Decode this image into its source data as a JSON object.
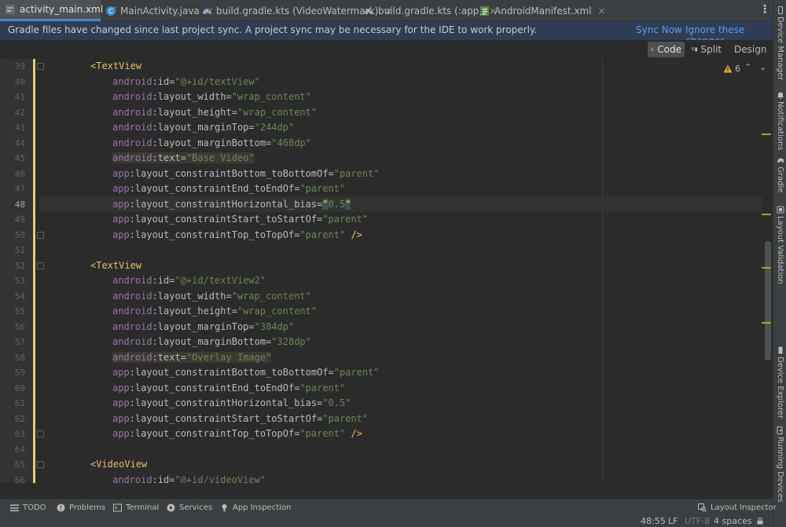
{
  "tabs": [
    {
      "label": "activity_main.xml",
      "icon": "xml-layout-icon",
      "active": true
    },
    {
      "label": "MainActivity.java",
      "icon": "java-class-icon",
      "active": false
    },
    {
      "label": "build.gradle.kts (VideoWatermark)",
      "icon": "gradle-icon",
      "active": false
    },
    {
      "label": "build.gradle.kts (:app)",
      "icon": "gradle-icon",
      "active": false
    },
    {
      "label": "AndroidManifest.xml",
      "icon": "manifest-icon",
      "active": false
    }
  ],
  "tab_close_glyph": "×",
  "tab_menu_glyph": "⋮",
  "banner": {
    "text": "Gradle files have changed since last project sync. A project sync may be necessary for the IDE to work properly.",
    "sync_now": "Sync Now",
    "ignore": "Ignore these changes"
  },
  "view_modes": {
    "code": "Code",
    "split": "Split",
    "design": "Design"
  },
  "inspections": {
    "warning_count": "6",
    "up_glyph": "⌃",
    "down_glyph": "⌄"
  },
  "editor": {
    "current_line": "48",
    "lines": [
      {
        "n": "39",
        "tokens": [
          {
            "t": "tag",
            "v": "<TextView"
          }
        ]
      },
      {
        "n": "40",
        "tokens": [
          {
            "t": "ns",
            "v": "android"
          },
          {
            "t": "attr",
            "v": ":id="
          },
          {
            "t": "str",
            "v": "\"@+id/textView\""
          }
        ]
      },
      {
        "n": "41",
        "tokens": [
          {
            "t": "ns",
            "v": "android"
          },
          {
            "t": "attr",
            "v": ":layout_width="
          },
          {
            "t": "str",
            "v": "\"wrap_content\""
          }
        ]
      },
      {
        "n": "42",
        "tokens": [
          {
            "t": "ns",
            "v": "android"
          },
          {
            "t": "attr",
            "v": ":layout_height="
          },
          {
            "t": "str",
            "v": "\"wrap_content\""
          }
        ]
      },
      {
        "n": "43",
        "tokens": [
          {
            "t": "ns",
            "v": "android"
          },
          {
            "t": "attr",
            "v": ":layout_marginTop="
          },
          {
            "t": "str",
            "v": "\"244dp\""
          }
        ]
      },
      {
        "n": "44",
        "tokens": [
          {
            "t": "ns",
            "v": "android"
          },
          {
            "t": "attr",
            "v": ":layout_marginBottom="
          },
          {
            "t": "str",
            "v": "\"468dp\""
          }
        ]
      },
      {
        "n": "45",
        "hl": true,
        "tokens": [
          {
            "t": "ns",
            "v": "android"
          },
          {
            "t": "attr",
            "v": ":text="
          },
          {
            "t": "str",
            "v": "\"Base Video\""
          }
        ]
      },
      {
        "n": "46",
        "tokens": [
          {
            "t": "ns",
            "v": "app"
          },
          {
            "t": "attr",
            "v": ":layout_constraintBottom_toBottomOf="
          },
          {
            "t": "str",
            "v": "\"parent\""
          }
        ]
      },
      {
        "n": "47",
        "tokens": [
          {
            "t": "ns",
            "v": "app"
          },
          {
            "t": "attr",
            "v": ":layout_constraintEnd_toEndOf="
          },
          {
            "t": "str",
            "v": "\"parent\""
          }
        ]
      },
      {
        "n": "48",
        "tokens": [
          {
            "t": "ns",
            "v": "app"
          },
          {
            "t": "attr",
            "v": ":layout_constraintHorizontal_bias="
          },
          {
            "t": "bracehl",
            "v": "\""
          },
          {
            "t": "str",
            "v": "0.5"
          },
          {
            "t": "bracehl",
            "v": "\""
          }
        ]
      },
      {
        "n": "49",
        "tokens": [
          {
            "t": "ns",
            "v": "app"
          },
          {
            "t": "attr",
            "v": ":layout_constraintStart_toStartOf="
          },
          {
            "t": "str",
            "v": "\"parent\""
          }
        ]
      },
      {
        "n": "50",
        "tokens": [
          {
            "t": "ns",
            "v": "app"
          },
          {
            "t": "attr",
            "v": ":layout_constraintTop_toTopOf="
          },
          {
            "t": "str",
            "v": "\"parent\""
          },
          {
            "t": "tag",
            "v": " />"
          }
        ]
      },
      {
        "n": "51",
        "tokens": []
      },
      {
        "n": "52",
        "tokens": [
          {
            "t": "tag",
            "v": "<TextView"
          }
        ]
      },
      {
        "n": "53",
        "tokens": [
          {
            "t": "ns",
            "v": "android"
          },
          {
            "t": "attr",
            "v": ":id="
          },
          {
            "t": "str",
            "v": "\"@+id/textView2\""
          }
        ]
      },
      {
        "n": "54",
        "tokens": [
          {
            "t": "ns",
            "v": "android"
          },
          {
            "t": "attr",
            "v": ":layout_width="
          },
          {
            "t": "str",
            "v": "\"wrap_content\""
          }
        ]
      },
      {
        "n": "55",
        "tokens": [
          {
            "t": "ns",
            "v": "android"
          },
          {
            "t": "attr",
            "v": ":layout_height="
          },
          {
            "t": "str",
            "v": "\"wrap_content\""
          }
        ]
      },
      {
        "n": "56",
        "tokens": [
          {
            "t": "ns",
            "v": "android"
          },
          {
            "t": "attr",
            "v": ":layout_marginTop="
          },
          {
            "t": "str",
            "v": "\"384dp\""
          }
        ]
      },
      {
        "n": "57",
        "tokens": [
          {
            "t": "ns",
            "v": "android"
          },
          {
            "t": "attr",
            "v": ":layout_marginBottom="
          },
          {
            "t": "str",
            "v": "\"328dp\""
          }
        ]
      },
      {
        "n": "58",
        "hl": true,
        "tokens": [
          {
            "t": "ns",
            "v": "android"
          },
          {
            "t": "attr",
            "v": ":text="
          },
          {
            "t": "str",
            "v": "\"Overlay Image\""
          }
        ]
      },
      {
        "n": "59",
        "tokens": [
          {
            "t": "ns",
            "v": "app"
          },
          {
            "t": "attr",
            "v": ":layout_constraintBottom_toBottomOf="
          },
          {
            "t": "str",
            "v": "\"parent\""
          }
        ]
      },
      {
        "n": "60",
        "tokens": [
          {
            "t": "ns",
            "v": "app"
          },
          {
            "t": "attr",
            "v": ":layout_constraintEnd_toEndOf="
          },
          {
            "t": "str",
            "v": "\"parent\""
          }
        ]
      },
      {
        "n": "61",
        "tokens": [
          {
            "t": "ns",
            "v": "app"
          },
          {
            "t": "attr",
            "v": ":layout_constraintHorizontal_bias="
          },
          {
            "t": "str",
            "v": "\"0.5\""
          }
        ]
      },
      {
        "n": "62",
        "tokens": [
          {
            "t": "ns",
            "v": "app"
          },
          {
            "t": "attr",
            "v": ":layout_constraintStart_toStartOf="
          },
          {
            "t": "str",
            "v": "\"parent\""
          }
        ]
      },
      {
        "n": "63",
        "tokens": [
          {
            "t": "ns",
            "v": "app"
          },
          {
            "t": "attr",
            "v": ":layout_constraintTop_toTopOf="
          },
          {
            "t": "str",
            "v": "\"parent\""
          },
          {
            "t": "tag",
            "v": " />"
          }
        ]
      },
      {
        "n": "64",
        "tokens": []
      },
      {
        "n": "65",
        "tokens": [
          {
            "t": "tag",
            "v": "<VideoView"
          }
        ]
      },
      {
        "n": "66",
        "tokens": [
          {
            "t": "ns",
            "v": "android"
          },
          {
            "t": "attr",
            "v": ":id="
          },
          {
            "t": "str",
            "v": "\"@+id/videoView\""
          }
        ]
      }
    ]
  },
  "right_tools": [
    {
      "label": "Device Manager",
      "icon": "phone-icon"
    },
    {
      "label": "Notifications",
      "icon": "bell-icon"
    },
    {
      "label": "Gradle",
      "icon": "gradle-elephant-icon"
    },
    {
      "label": "Layout Validation",
      "icon": "layout-validation-icon"
    },
    {
      "label": "Device Explorer",
      "icon": "device-explorer-icon"
    },
    {
      "label": "Running Devices",
      "icon": "running-devices-icon"
    }
  ],
  "bottom_tools": {
    "todo": "TODO",
    "problems": "Problems",
    "terminal": "Terminal",
    "services": "Services",
    "app_inspection": "App Inspection",
    "layout_inspector": "Layout Inspector"
  },
  "status": {
    "position": "48:55",
    "line_separator": "LF",
    "encoding": "UTF-8",
    "indent": "4 spaces"
  },
  "colors": {
    "accent": "#4a88c7",
    "link": "#589df6",
    "banner_bg": "#2f3d54",
    "tag": "#e8bf6a",
    "namespace": "#9876aa",
    "string": "#6a8759",
    "warning": "#e0a82e"
  }
}
